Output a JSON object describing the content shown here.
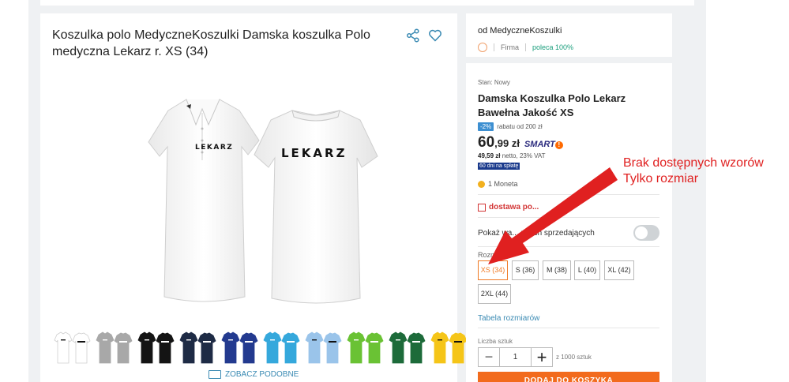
{
  "product": {
    "title": "Koszulka polo MedyczneKoszulki Damska koszulka Polo medyczna Lekarz r. XS (34)",
    "shirt_text": "LEKARZ",
    "similar_label": "ZOBACZ PODOBNE",
    "thumbnail_colors": [
      "#ffffff",
      "#a8a8a8",
      "#141414",
      "#1e2b45",
      "#233a8f",
      "#35a8dc",
      "#9ac4ea",
      "#6ac234",
      "#1d6b3a",
      "#f5c518"
    ]
  },
  "seller": {
    "name": "od MedyczneKoszulki",
    "type": "Firma",
    "recommend": "poleca 100%"
  },
  "offer": {
    "condition": "Stan: Nowy",
    "title": "Damska Koszulka Polo Lekarz Bawełna Jakość XS",
    "discount_badge": "-2%",
    "discount_text": "rabatu od 200 zł",
    "price_int": "60",
    "price_dec": ",99 zł",
    "smart": "SMART",
    "net_value": "49,59 zł",
    "net_text": "netto, 23% VAT",
    "installments": "60 dni na spłatę",
    "moneta": "1 Moneta",
    "delivery": "dostawa po...",
    "toggle_label": "Pokaż wa... nnych sprzedających",
    "size_label": "Rozmiar",
    "sizes": [
      "XS (34)",
      "S (36)",
      "M (38)",
      "L (40)",
      "XL (42)",
      "2XL (44)"
    ],
    "selected_size": "XS (34)",
    "size_table": "Tabela rozmiarów",
    "qty_label": "Liczba sztuk",
    "qty_value": "1",
    "qty_of": "z 1000 sztuk",
    "add_to_cart": "DODAJ DO KOSZYKA"
  },
  "annotation": {
    "line1": "Brak dostępnych wzorów",
    "line2": "Tylko rozmiar"
  },
  "colors": {
    "accent_orange": "#f26b1d",
    "link_blue": "#3a8ab3",
    "annotation_red": "#e02020"
  }
}
